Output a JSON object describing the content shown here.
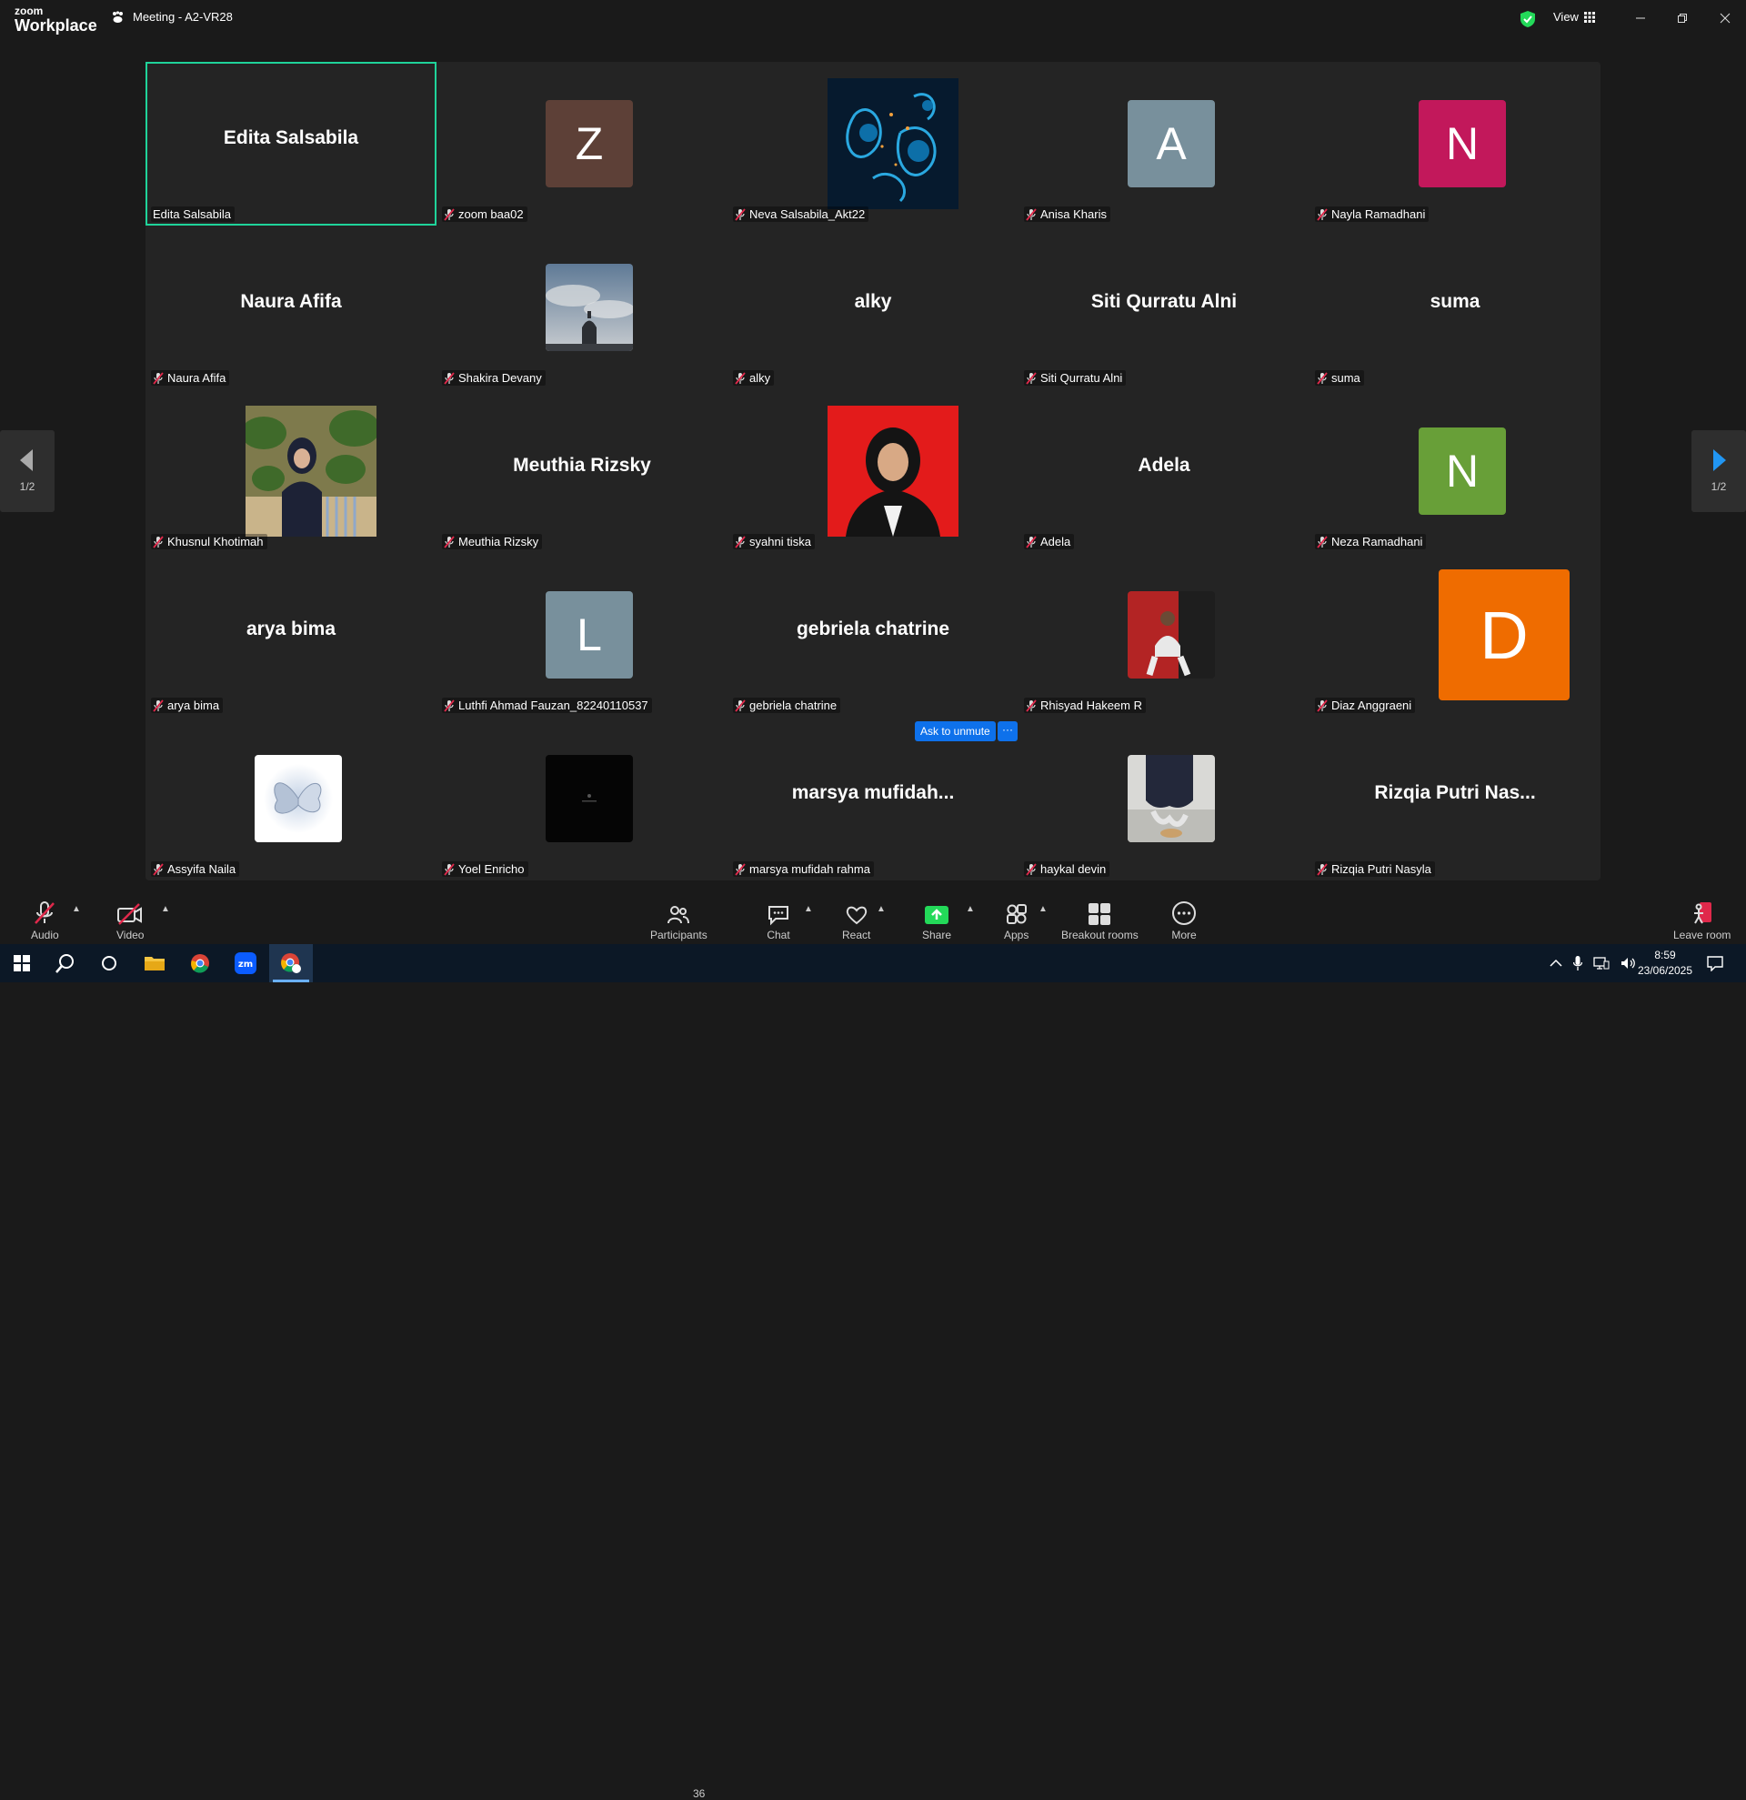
{
  "app": {
    "logo_top": "zoom",
    "logo_bottom": "Workplace",
    "meeting_title": "Meeting - A2-VR28",
    "view_label": "View"
  },
  "pager": {
    "left": "1/2",
    "right": "1/2"
  },
  "participants": [
    {
      "name": "Edita Salsabila",
      "display": "text",
      "big_name": "Edita Salsabila",
      "active": true,
      "muted": false
    },
    {
      "name": "zoom baa02",
      "display": "avatar",
      "letter": "Z",
      "color": "#5d4037",
      "muted": true
    },
    {
      "name": "Neva Salsabila_Akt22",
      "display": "photo",
      "photo": "flowers",
      "muted": true
    },
    {
      "name": "Anisa Kharis",
      "display": "avatar",
      "letter": "A",
      "color": "#78909c",
      "muted": true
    },
    {
      "name": "Nayla Ramadhani",
      "display": "avatar",
      "letter": "N",
      "color": "#c2185b",
      "muted": true
    },
    {
      "name": "Naura Afifa",
      "display": "text",
      "big_name": "Naura Afifa",
      "muted": true
    },
    {
      "name": "Shakira Devany",
      "display": "photo-small",
      "photo": "sky",
      "muted": true
    },
    {
      "name": "alky",
      "display": "text",
      "big_name": "alky",
      "muted": true
    },
    {
      "name": "Siti Qurratu Alni",
      "display": "text",
      "big_name": "Siti Qurratu Alni",
      "muted": true
    },
    {
      "name": "suma",
      "display": "text",
      "big_name": "suma",
      "muted": true
    },
    {
      "name": "Khusnul Khotimah",
      "display": "photo",
      "photo": "garden",
      "muted": true
    },
    {
      "name": "Meuthia Rizsky",
      "display": "text",
      "big_name": "Meuthia Rizsky",
      "muted": true
    },
    {
      "name": "syahni tiska",
      "display": "photo",
      "photo": "portrait-red",
      "muted": true
    },
    {
      "name": "Adela",
      "display": "text",
      "big_name": "Adela",
      "muted": true
    },
    {
      "name": "Neza Ramadhani",
      "display": "avatar",
      "letter": "N",
      "color": "#689f38",
      "muted": true
    },
    {
      "name": "arya bima",
      "display": "text",
      "big_name": "arya bima",
      "muted": true
    },
    {
      "name": "Luthfi Ahmad Fauzan_82240110537",
      "display": "avatar",
      "letter": "L",
      "color": "#78909c",
      "muted": true
    },
    {
      "name": "gebriela chatrine",
      "display": "text",
      "big_name": "gebriela chatrine",
      "muted": true
    },
    {
      "name": "Rhisyad Hakeem R",
      "display": "photo-small",
      "photo": "man-red",
      "muted": true
    },
    {
      "name": "Diaz Anggraeni",
      "display": "avatar-big",
      "letter": "D",
      "color": "#ef6c00",
      "muted": true
    },
    {
      "name": "Assyifa Naila",
      "display": "photo-small",
      "photo": "butterfly",
      "muted": true
    },
    {
      "name": "Yoel Enricho",
      "display": "photo-small",
      "photo": "black",
      "muted": true
    },
    {
      "name": "marsya mufidah rahma",
      "display": "text",
      "big_name": "marsya  mufidah...",
      "muted": true
    },
    {
      "name": "haykal devin",
      "display": "photo-small",
      "photo": "shoes",
      "muted": true
    },
    {
      "name": "Rizqia Putri Nasyla",
      "display": "text",
      "big_name": "Rizqia Putri Nas...",
      "muted": true
    }
  ],
  "ask_unmute": {
    "label": "Ask to unmute",
    "more": "···"
  },
  "toolbar": {
    "audio": "Audio",
    "video": "Video",
    "participants": "Participants",
    "participants_count": "36",
    "chat": "Chat",
    "react": "React",
    "share": "Share",
    "apps": "Apps",
    "breakout": "Breakout rooms",
    "more": "More",
    "leave": "Leave room"
  },
  "taskbar": {
    "time": "8:59",
    "date": "23/06/2025"
  },
  "colors": {
    "active_border": "#1fd39a",
    "accent_blue": "#0e71eb",
    "share_green": "#23d959",
    "mute_red": "#e0294b"
  }
}
